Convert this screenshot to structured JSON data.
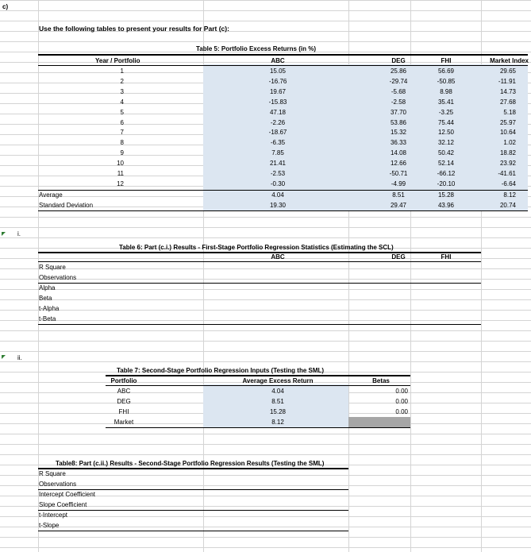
{
  "part_label": "c)",
  "instruction": "Use the following tables to present your results for Part (c):",
  "table5": {
    "title": "Table 5: Portfolio Excess Returns (in %)",
    "headers": [
      "Year / Portfolio",
      "ABC",
      "DEG",
      "FHI",
      "Market Index"
    ],
    "rows": [
      [
        "1",
        "15.05",
        "25.86",
        "56.69",
        "29.65"
      ],
      [
        "2",
        "-16.76",
        "-29.74",
        "-50.85",
        "-11.91"
      ],
      [
        "3",
        "19.67",
        "-5.68",
        "8.98",
        "14.73"
      ],
      [
        "4",
        "-15.83",
        "-2.58",
        "35.41",
        "27.68"
      ],
      [
        "5",
        "47.18",
        "37.70",
        "-3.25",
        "5.18"
      ],
      [
        "6",
        "-2.26",
        "53.86",
        "75.44",
        "25.97"
      ],
      [
        "7",
        "-18.67",
        "15.32",
        "12.50",
        "10.64"
      ],
      [
        "8",
        "-6.35",
        "36.33",
        "32.12",
        "1.02"
      ],
      [
        "9",
        "7.85",
        "14.08",
        "50.42",
        "18.82"
      ],
      [
        "10",
        "21.41",
        "12.66",
        "52.14",
        "23.92"
      ],
      [
        "11",
        "-2.53",
        "-50.71",
        "-66.12",
        "-41.61"
      ],
      [
        "12",
        "-0.30",
        "-4.99",
        "-20.10",
        "-6.64"
      ]
    ],
    "average_label": "Average",
    "average": [
      "4.04",
      "8.51",
      "15.28",
      "8.12"
    ],
    "sd_label": "Standard Deviation",
    "sd": [
      "19.30",
      "29.47",
      "43.96",
      "20.74"
    ]
  },
  "section_i": "i.",
  "table6": {
    "title": "Table 6: Part (c.i.) Results - First-Stage Portfolio Regression Statistics (Estimating the SCL)",
    "headers": [
      "ABC",
      "DEG",
      "FHI"
    ],
    "rows": [
      "R Square",
      "Observations",
      "Alpha",
      "Beta",
      "t-Alpha",
      "t-Beta"
    ]
  },
  "section_ii": "ii.",
  "table7": {
    "title": "Table 7: Second-Stage Portfolio Regression Inputs (Testing the SML)",
    "headers": [
      "Portfolio",
      "Average Excess Return",
      "Betas"
    ],
    "rows": [
      [
        "ABC",
        "4.04",
        "0.00"
      ],
      [
        "DEG",
        "8.51",
        "0.00"
      ],
      [
        "FHI",
        "15.28",
        "0.00"
      ],
      [
        "Market",
        "8.12",
        ""
      ]
    ]
  },
  "table8": {
    "title": "Table8: Part (c.ii.) Results - Second-Stage Portfolio Regression Results (Testing the SML)",
    "rows": [
      "R Square",
      "Observations",
      "Intercept Coefficient",
      "Slope Coefficient",
      "t-Intercept",
      "t-Slope"
    ]
  },
  "colors": {
    "shade": "#dce6f1",
    "gray_cell": "#a6a6a6",
    "gridline": "#d4d4d4",
    "marker": "#2e7d32"
  }
}
